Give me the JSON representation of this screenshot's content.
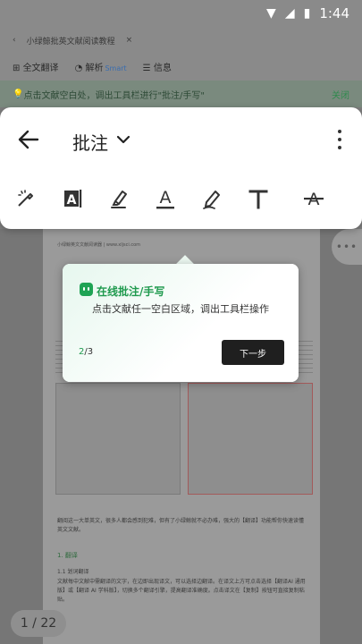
{
  "status": {
    "time": "1:44"
  },
  "app": {
    "doc_title": "小绿鲸批英文献阅读教程",
    "close_tab": "×",
    "menu": [
      "全文翻译",
      "解析",
      "信息"
    ],
    "beta_badge": "Smart",
    "tip": "点击文献空白处，调出工具栏进行\"批注/手写\"",
    "tip_close": "关闭"
  },
  "toolbar": {
    "mode_label": "批注",
    "tools": [
      {
        "name": "magic-pen-icon"
      },
      {
        "name": "text-highlight-icon"
      },
      {
        "name": "highlighter-icon"
      },
      {
        "name": "underline-icon"
      },
      {
        "name": "pen-icon"
      },
      {
        "name": "text-icon"
      },
      {
        "name": "strikethrough-icon"
      }
    ]
  },
  "guide": {
    "title": "在线批注/手写",
    "desc": "点击文献任一空白区域，调出工具栏操作",
    "step_current": "2",
    "step_total": "/3",
    "next_button": "下一步"
  },
  "document": {
    "page_header": "小绿鲸英文文献阅读器 | www.xljsci.com",
    "para1": "翻阅这一大单英文，很多人都会感到犯难，但有了小绿鲸就不必办难，强大的【翻译】功能帮你快速读懂英文文献。",
    "section": "1. 翻译",
    "subsection": "1.1 划词翻译",
    "para2": "文献每中文献中需翻译的文字，在边即出现译文，可以选择边翻译。在译文上方可点击选择【翻译AI 通用版】或【翻译 AI 学科版】，切换多个翻译引擎，提高翻译准确度。点击译文在【复制】按钮可直接复制粘贴。",
    "page_indicator": "1 / 22"
  }
}
